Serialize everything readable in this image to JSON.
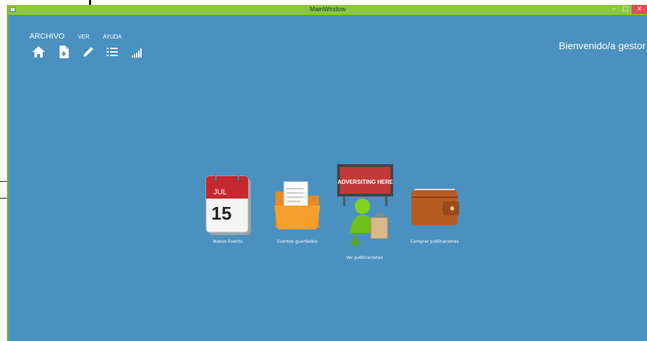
{
  "window": {
    "title": "MainWindow",
    "buttons": {
      "minimize": "–",
      "maximize": "□",
      "close": "×"
    }
  },
  "menu": {
    "archivo": "ARCHIVO",
    "ver": "VER",
    "ayuda": "AYUDA"
  },
  "toolbar": [
    "home-icon",
    "new-document-icon",
    "edit-pencil-icon",
    "list-icon",
    "signal-bars-icon"
  ],
  "welcome": "Bienvenido/a gestor",
  "tiles": [
    {
      "label": "Nuevo Evento",
      "icon": "calendar-icon",
      "calendar_month": "JUL",
      "calendar_day": "15"
    },
    {
      "label": "Eventos guardados",
      "icon": "folder-icon"
    },
    {
      "label": "Ver publicaciones",
      "icon": "advertising-billboard-icon",
      "billboard_text": "ADVERSITING HERE"
    },
    {
      "label": "Comprar publicaciones",
      "icon": "wallet-icon"
    }
  ],
  "colors": {
    "background": "#4a91bf",
    "titlebar": "#8dc63f",
    "close": "#d9534f"
  }
}
